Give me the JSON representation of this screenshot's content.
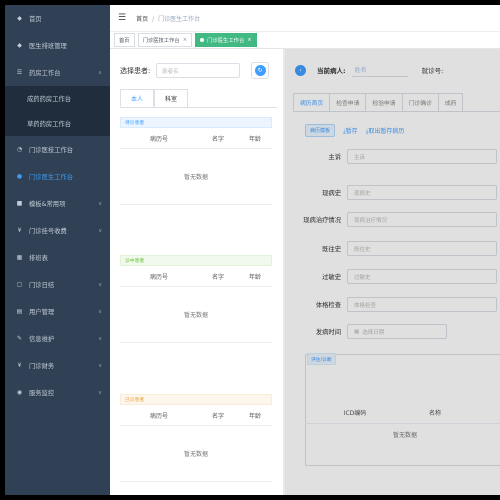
{
  "sidebar": {
    "items": [
      {
        "label": "首页",
        "icon": "dashboard-icon",
        "glyph": "◆",
        "chevron": ""
      },
      {
        "label": "医生排班管理",
        "icon": "schedule-icon",
        "glyph": "◆",
        "chevron": ""
      },
      {
        "label": "药房工作台",
        "icon": "pharmacy-icon",
        "glyph": "☰",
        "chevron": "∧"
      },
      {
        "label": "门诊医技工作台",
        "icon": "clinic-icon",
        "glyph": "◔",
        "chevron": ""
      },
      {
        "label": "门诊医生工作台",
        "icon": "doctor-icon",
        "glyph": "●",
        "chevron": ""
      },
      {
        "label": "模板&常用项",
        "icon": "template-icon",
        "glyph": "■",
        "chevron": "∨"
      },
      {
        "label": "门诊挂号收费",
        "icon": "yen-icon",
        "glyph": "¥",
        "chevron": "∨"
      },
      {
        "label": "排班表",
        "icon": "calendar-icon",
        "glyph": "▦",
        "chevron": ""
      },
      {
        "label": "门诊日结",
        "icon": "daily-settle-icon",
        "glyph": "▢",
        "chevron": "∨"
      },
      {
        "label": "用户管理",
        "icon": "user-icon",
        "glyph": "▤",
        "chevron": "∨"
      },
      {
        "label": "信息维护",
        "icon": "edit-icon",
        "glyph": "✎",
        "chevron": "∨"
      },
      {
        "label": "门诊财务",
        "icon": "finance-icon",
        "glyph": "¥",
        "chevron": "∨"
      },
      {
        "label": "服务监控",
        "icon": "monitor-icon",
        "glyph": "◉",
        "chevron": "∨"
      }
    ],
    "subitems": [
      "成药药房工作台",
      "草药药房工作台"
    ]
  },
  "breadcrumb": {
    "home": "首页",
    "sep": "/",
    "current": "门诊医生工作台"
  },
  "tags": [
    {
      "label": "首页"
    },
    {
      "label": "门诊医技工作台"
    },
    {
      "label": "门诊医生工作台"
    }
  ],
  "left": {
    "select_label": "选择患者:",
    "search_placeholder": "患者名",
    "search_glyph": "↻",
    "tabs": [
      "本人",
      "科室"
    ],
    "sections": [
      {
        "tag": "待诊患者"
      },
      {
        "tag": "诊中患者"
      },
      {
        "tag": "已诊患者"
      }
    ],
    "columns": [
      "病历号",
      "名字",
      "年龄"
    ],
    "empty_text": "暂无数据"
  },
  "right": {
    "collapse_glyph": "‹",
    "current_patient_label": "当前病人:",
    "name_placeholder": "姓名",
    "visit_no_label": "就诊号:",
    "tabs": [
      "病历首页",
      "检查申请",
      "检验申请",
      "门诊确诊",
      "成药"
    ],
    "template_btn": "病历模板",
    "save_draft": "暂存",
    "load_draft": "取出暂存病历",
    "save_glyph": "⤓",
    "load_glyph": "⤓",
    "fields": [
      {
        "label": "主诉",
        "placeholder": "主诉"
      },
      {
        "label": "现病史",
        "placeholder": "现病史"
      },
      {
        "label": "现病治疗情况",
        "placeholder": "现病治疗情况"
      },
      {
        "label": "既往史",
        "placeholder": "既往史"
      },
      {
        "label": "过敏史",
        "placeholder": "过敏史"
      },
      {
        "label": "体格检查",
        "placeholder": "体格检查"
      },
      {
        "label": "发病时间",
        "placeholder": "选择日期"
      }
    ],
    "date_glyph": "▦",
    "icd_tag": "评估/诊断",
    "icd_columns": [
      "ICD编码",
      "名称"
    ],
    "icd_empty": "暂无数据"
  },
  "colors": {
    "sidebar_bg": "#304156",
    "accent": "#409eff",
    "active_tag": "#42b983"
  }
}
